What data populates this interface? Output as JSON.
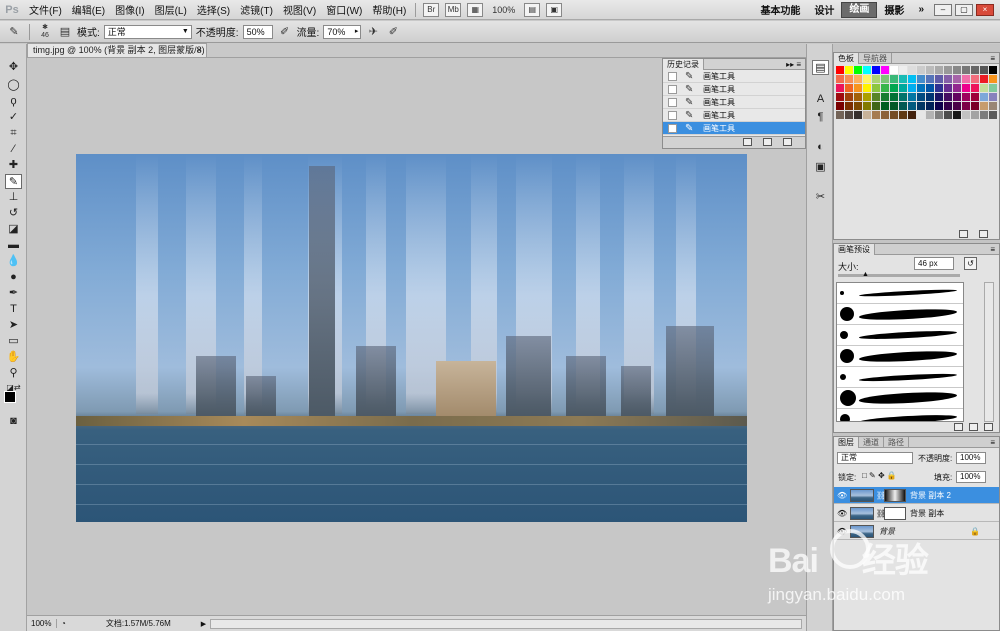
{
  "app": {
    "logo": "Ps"
  },
  "menu": [
    "文件(F)",
    "编辑(E)",
    "图像(I)",
    "图层(L)",
    "选择(S)",
    "滤镜(T)",
    "视图(V)",
    "窗口(W)",
    "帮助(H)"
  ],
  "menubar_tools": {
    "br": "Br",
    "mb": "Mb",
    "zoom": "100%"
  },
  "workspaces": [
    {
      "label": "基本功能",
      "active": false
    },
    {
      "label": "设计",
      "active": false
    },
    {
      "label": "绘画",
      "active": true
    },
    {
      "label": "摄影",
      "active": false
    }
  ],
  "workspace_more": "»",
  "options": {
    "brush_size": "46",
    "mode_label": "模式:",
    "mode_value": "正常",
    "opacity_label": "不透明度:",
    "opacity_value": "50%",
    "flow_label": "流量:",
    "flow_value": "70%"
  },
  "document": {
    "tab_title": "timg.jpg @ 100% (背景 副本 2, 图层蒙版/8) *",
    "close": "×"
  },
  "status": {
    "zoom": "100%",
    "doc_info": "文档:1.57M/5.76M"
  },
  "history": {
    "tab": "历史记录",
    "rows": [
      {
        "label": "画笔工具",
        "selected": false
      },
      {
        "label": "画笔工具",
        "selected": false
      },
      {
        "label": "画笔工具",
        "selected": false
      },
      {
        "label": "画笔工具",
        "selected": false
      },
      {
        "label": "画笔工具",
        "selected": true
      }
    ]
  },
  "swatches": {
    "tabs": [
      {
        "label": "色板",
        "active": true
      },
      {
        "label": "导航器",
        "active": false
      }
    ],
    "colors": [
      "#ff0000",
      "#ffff00",
      "#00ff00",
      "#00ffff",
      "#0000ff",
      "#ff00ff",
      "#ffffff",
      "#eeeeee",
      "#dddddd",
      "#cccccc",
      "#bbbbbb",
      "#aaaaaa",
      "#999999",
      "#888888",
      "#777777",
      "#666666",
      "#555555",
      "#000000",
      "#f26c4f",
      "#f68e55",
      "#fbaf5c",
      "#fff467",
      "#acd372",
      "#7cc576",
      "#3bb878",
      "#1abbb4",
      "#00bff3",
      "#438ccb",
      "#5574b9",
      "#605ca8",
      "#855fa8",
      "#a763a9",
      "#f06ea9",
      "#f26d7d",
      "#ed1c24",
      "#f7941d",
      "#ed145b",
      "#f26522",
      "#f7941d",
      "#fff200",
      "#8dc63f",
      "#39b54a",
      "#00a651",
      "#00a99d",
      "#00aeef",
      "#0072bc",
      "#0054a6",
      "#2e3192",
      "#662d91",
      "#92278f",
      "#ec008c",
      "#ed145b",
      "#c4df9b",
      "#82ca9c",
      "#9e0b0f",
      "#a0410d",
      "#a3620a",
      "#aba000",
      "#598527",
      "#1a7b30",
      "#007236",
      "#00746b",
      "#0076a3",
      "#004a80",
      "#003471",
      "#1b1464",
      "#440e62",
      "#630460",
      "#9e005d",
      "#9e0039",
      "#7da7d9",
      "#8781bd",
      "#790000",
      "#7b2e00",
      "#7d4900",
      "#827b00",
      "#406618",
      "#005e20",
      "#005826",
      "#005952",
      "#005b7f",
      "#003663",
      "#002157",
      "#0d004c",
      "#32004b",
      "#4b0049",
      "#7b0046",
      "#7a0026",
      "#c69c6d",
      "#998675",
      "#736357",
      "#534741",
      "#362f2d",
      "#c7b299",
      "#a67c52",
      "#8c6239",
      "#754c24",
      "#603913",
      "#42210b",
      "#e6e6e6",
      "#b3b3b3",
      "#808080",
      "#4d4d4d",
      "#1a1a1a",
      "#c2c2c2",
      "#a3a3a3",
      "#7d7d7d",
      "#5a5a5a"
    ]
  },
  "brush_presets": {
    "tab": "画笔预设",
    "size_label": "大小:",
    "size_value": "46 px",
    "rows": [
      {
        "dot": 4
      },
      {
        "dot": 14
      },
      {
        "dot": 8
      },
      {
        "dot": 14
      },
      {
        "dot": 6
      },
      {
        "dot": 16
      },
      {
        "dot": 10
      }
    ]
  },
  "layers": {
    "tabs": [
      {
        "label": "图层",
        "active": true
      },
      {
        "label": "通道",
        "active": false
      },
      {
        "label": "路径",
        "active": false
      }
    ],
    "blend_mode": "正常",
    "opacity_label": "不透明度:",
    "opacity_value": "100%",
    "lock_label": "锁定:",
    "fill_label": "填充:",
    "fill_value": "100%",
    "rows": [
      {
        "name": "背景 副本 2",
        "selected": true,
        "mask": "dark",
        "italic": false
      },
      {
        "name": "背景 副本",
        "selected": false,
        "mask": "white",
        "italic": false
      },
      {
        "name": "背景",
        "selected": false,
        "mask": "none",
        "italic": true
      }
    ]
  },
  "watermark": {
    "brand_left": "Bai",
    "brand_right": "经验",
    "url": "jingyan.baidu.com"
  }
}
